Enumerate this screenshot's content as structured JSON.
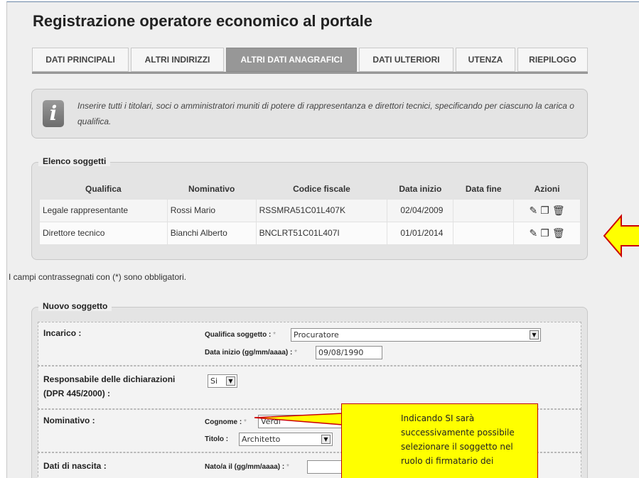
{
  "page": {
    "title": "Registrazione operatore economico al portale"
  },
  "tabs": [
    {
      "label": "DATI PRINCIPALI",
      "active": false
    },
    {
      "label": "ALTRI INDIRIZZI",
      "active": false
    },
    {
      "label": "ALTRI DATI ANAGRAFICI",
      "active": true
    },
    {
      "label": "DATI ULTERIORI",
      "active": false
    },
    {
      "label": "UTENZA",
      "active": false
    },
    {
      "label": "RIEPILOGO",
      "active": false
    }
  ],
  "info": {
    "icon": "info-icon",
    "text": "Inserire tutti i titolari, soci o amministratori muniti di potere di rappresentanza e direttori tecnici, specificando per ciascuno la carica o qualifica."
  },
  "elenco": {
    "legend": "Elenco soggetti",
    "columns": [
      "Qualifica",
      "Nominativo",
      "Codice fiscale",
      "Data inizio",
      "Data fine",
      "Azioni"
    ],
    "rows": [
      {
        "qualifica": "Legale rappresentante",
        "nominativo": "Rossi Mario",
        "codice_fiscale": "RSSMRA51C01L407K",
        "data_inizio": "02/04/2009",
        "data_fine": "",
        "azioni": [
          "edit-icon",
          "copy-icon",
          "delete-icon"
        ]
      },
      {
        "qualifica": "Direttore tecnico",
        "nominativo": "Bianchi Alberto",
        "codice_fiscale": "BNCLRT51C01L407I",
        "data_inizio": "01/01/2014",
        "data_fine": "",
        "azioni": [
          "edit-icon",
          "copy-icon",
          "delete-icon"
        ]
      }
    ]
  },
  "mandatory_note": "I campi contrassegnati con (*) sono obbligatori.",
  "nuovo": {
    "legend": "Nuovo soggetto",
    "incarico": {
      "label": "Incarico :",
      "qualifica_label": "Qualifica soggetto :",
      "qualifica_value": "Procuratore",
      "data_inizio_label": "Data inizio (gg/mm/aaaa) :",
      "data_inizio_value": "09/08/1990"
    },
    "responsabile": {
      "label_line1": "Responsabile delle dichiarazioni",
      "label_line2": "(DPR 445/2000) :",
      "value": "Si"
    },
    "nominativo": {
      "label": "Nominativo :",
      "cognome_label": "Cognome :",
      "cognome_value": "Verdi",
      "titolo_label": "Titolo :",
      "titolo_value": "Architetto"
    },
    "nascita": {
      "label": "Dati di nascita :",
      "nato_il_label": "Nato/a il (gg/mm/aaaa) :",
      "nato_il_value": ""
    },
    "required_mark": "*"
  },
  "callout": {
    "text": "Indicando SI sarà successivamente  possibile selezionare il soggetto nel ruolo di firmatario dei",
    "color": "#ffff00",
    "arrow_color": "#ffff00",
    "arrow_border": "#cc0000"
  },
  "colors": {
    "active_tab": "#979797",
    "panel": "#e4e4e4",
    "background": "#efefef"
  }
}
